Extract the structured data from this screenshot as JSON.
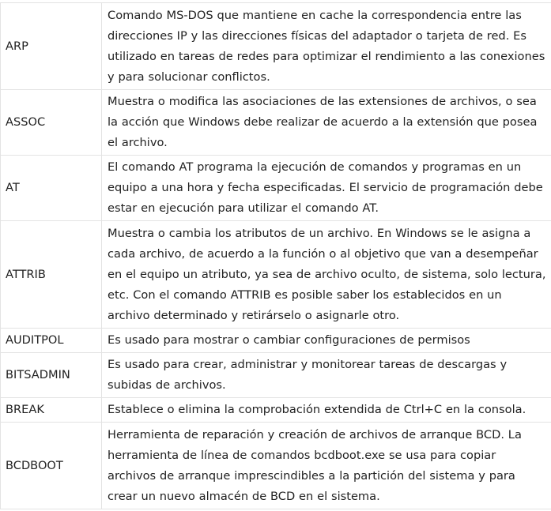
{
  "commands": [
    {
      "name": "ARP",
      "description": "Comando MS-DOS que mantiene en cache la correspondencia entre las direcciones IP y las direcciones físicas del adaptador o tarjeta de red. Es utilizado en tareas de redes para optimizar el rendimiento a las conexiones y para solucionar conflictos."
    },
    {
      "name": "ASSOC",
      "description": "Muestra o modifica las asociaciones de las extensiones de archivos, o sea la acción que Windows debe realizar de acuerdo a la extensión que posea el archivo."
    },
    {
      "name": "AT",
      "description": "El comando AT programa la ejecución de comandos y programas en un equipo a una hora y fecha especificadas. El servicio de programación debe estar en ejecución para utilizar el comando AT."
    },
    {
      "name": "ATTRIB",
      "description": "Muestra o cambia los atributos de un archivo. En Windows se le asigna a cada archivo, de acuerdo a la función o al objetivo que van a desempeñar en el equipo un atributo, ya sea de archivo oculto, de sistema, solo lectura, etc. Con el comando ATTRIB es posible saber los establecidos en un archivo determinado y retirárselo o asignarle otro."
    },
    {
      "name": "AUDITPOL",
      "description": "Es usado para mostrar o cambiar configuraciones de permisos"
    },
    {
      "name": "BITSADMIN",
      "description": "Es usado para crear, administrar y monitorear tareas de descargas y subidas de archivos."
    },
    {
      "name": "BREAK",
      "description": "Establece o elimina la comprobación extendida de Ctrl+C en la consola."
    },
    {
      "name": "BCDBOOT",
      "description": "Herramienta de reparación y creación de archivos de arranque BCD. La herramienta de línea de comandos bcdboot.exe se usa para copiar archivos de arranque imprescindibles a la partición del sistema y para crear un nuevo almacén de BCD en el sistema."
    }
  ]
}
